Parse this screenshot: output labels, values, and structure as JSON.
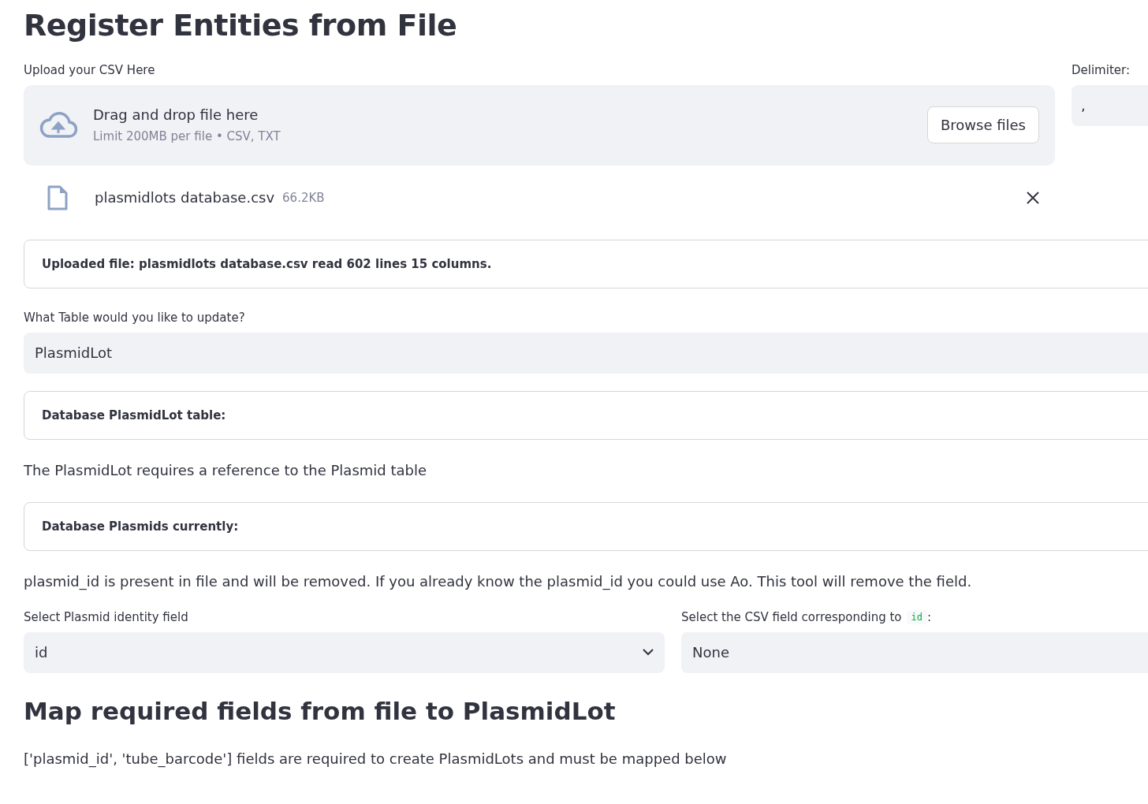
{
  "title": "Register Entities from File",
  "uploader": {
    "label": "Upload your CSV Here",
    "drop_text": "Drag and drop file here",
    "limit_text": "Limit 200MB per file • CSV, TXT",
    "button": "Browse files"
  },
  "delimiter": {
    "label": "Delimiter:",
    "value": ","
  },
  "uploaded_file": {
    "name": "plasmidlots database.csv",
    "size": "66.2KB"
  },
  "sections": [
    {
      "kind": "box",
      "text": "Uploaded file: plasmidlots database.csv read 602 lines 15 columns."
    },
    {
      "kind": "select",
      "label": "What Table would you like to update?",
      "value": "PlasmidLot"
    },
    {
      "kind": "box",
      "text": "Database PlasmidLot table:"
    },
    {
      "kind": "paragraph",
      "text": "The PlasmidLot requires a reference to the Plasmid table"
    },
    {
      "kind": "box",
      "text": "Database Plasmids currently:"
    },
    {
      "kind": "paragraph",
      "text": "plasmid_id is present in file and will be removed. If you already know the plasmid_id you could use Ao. This tool will remove the field."
    }
  ],
  "selects": [
    {
      "label": "Select Plasmid identity field",
      "value": "id"
    },
    {
      "label": "Select the CSV field corresponding to",
      "code": "id",
      "suffix": ":",
      "value": "None"
    }
  ],
  "heading": "Map required fields from file to PlasmidLot",
  "footer": "['plasmid_id', 'tube_barcode'] fields are required to create PlasmidLots and must be mapped below"
}
